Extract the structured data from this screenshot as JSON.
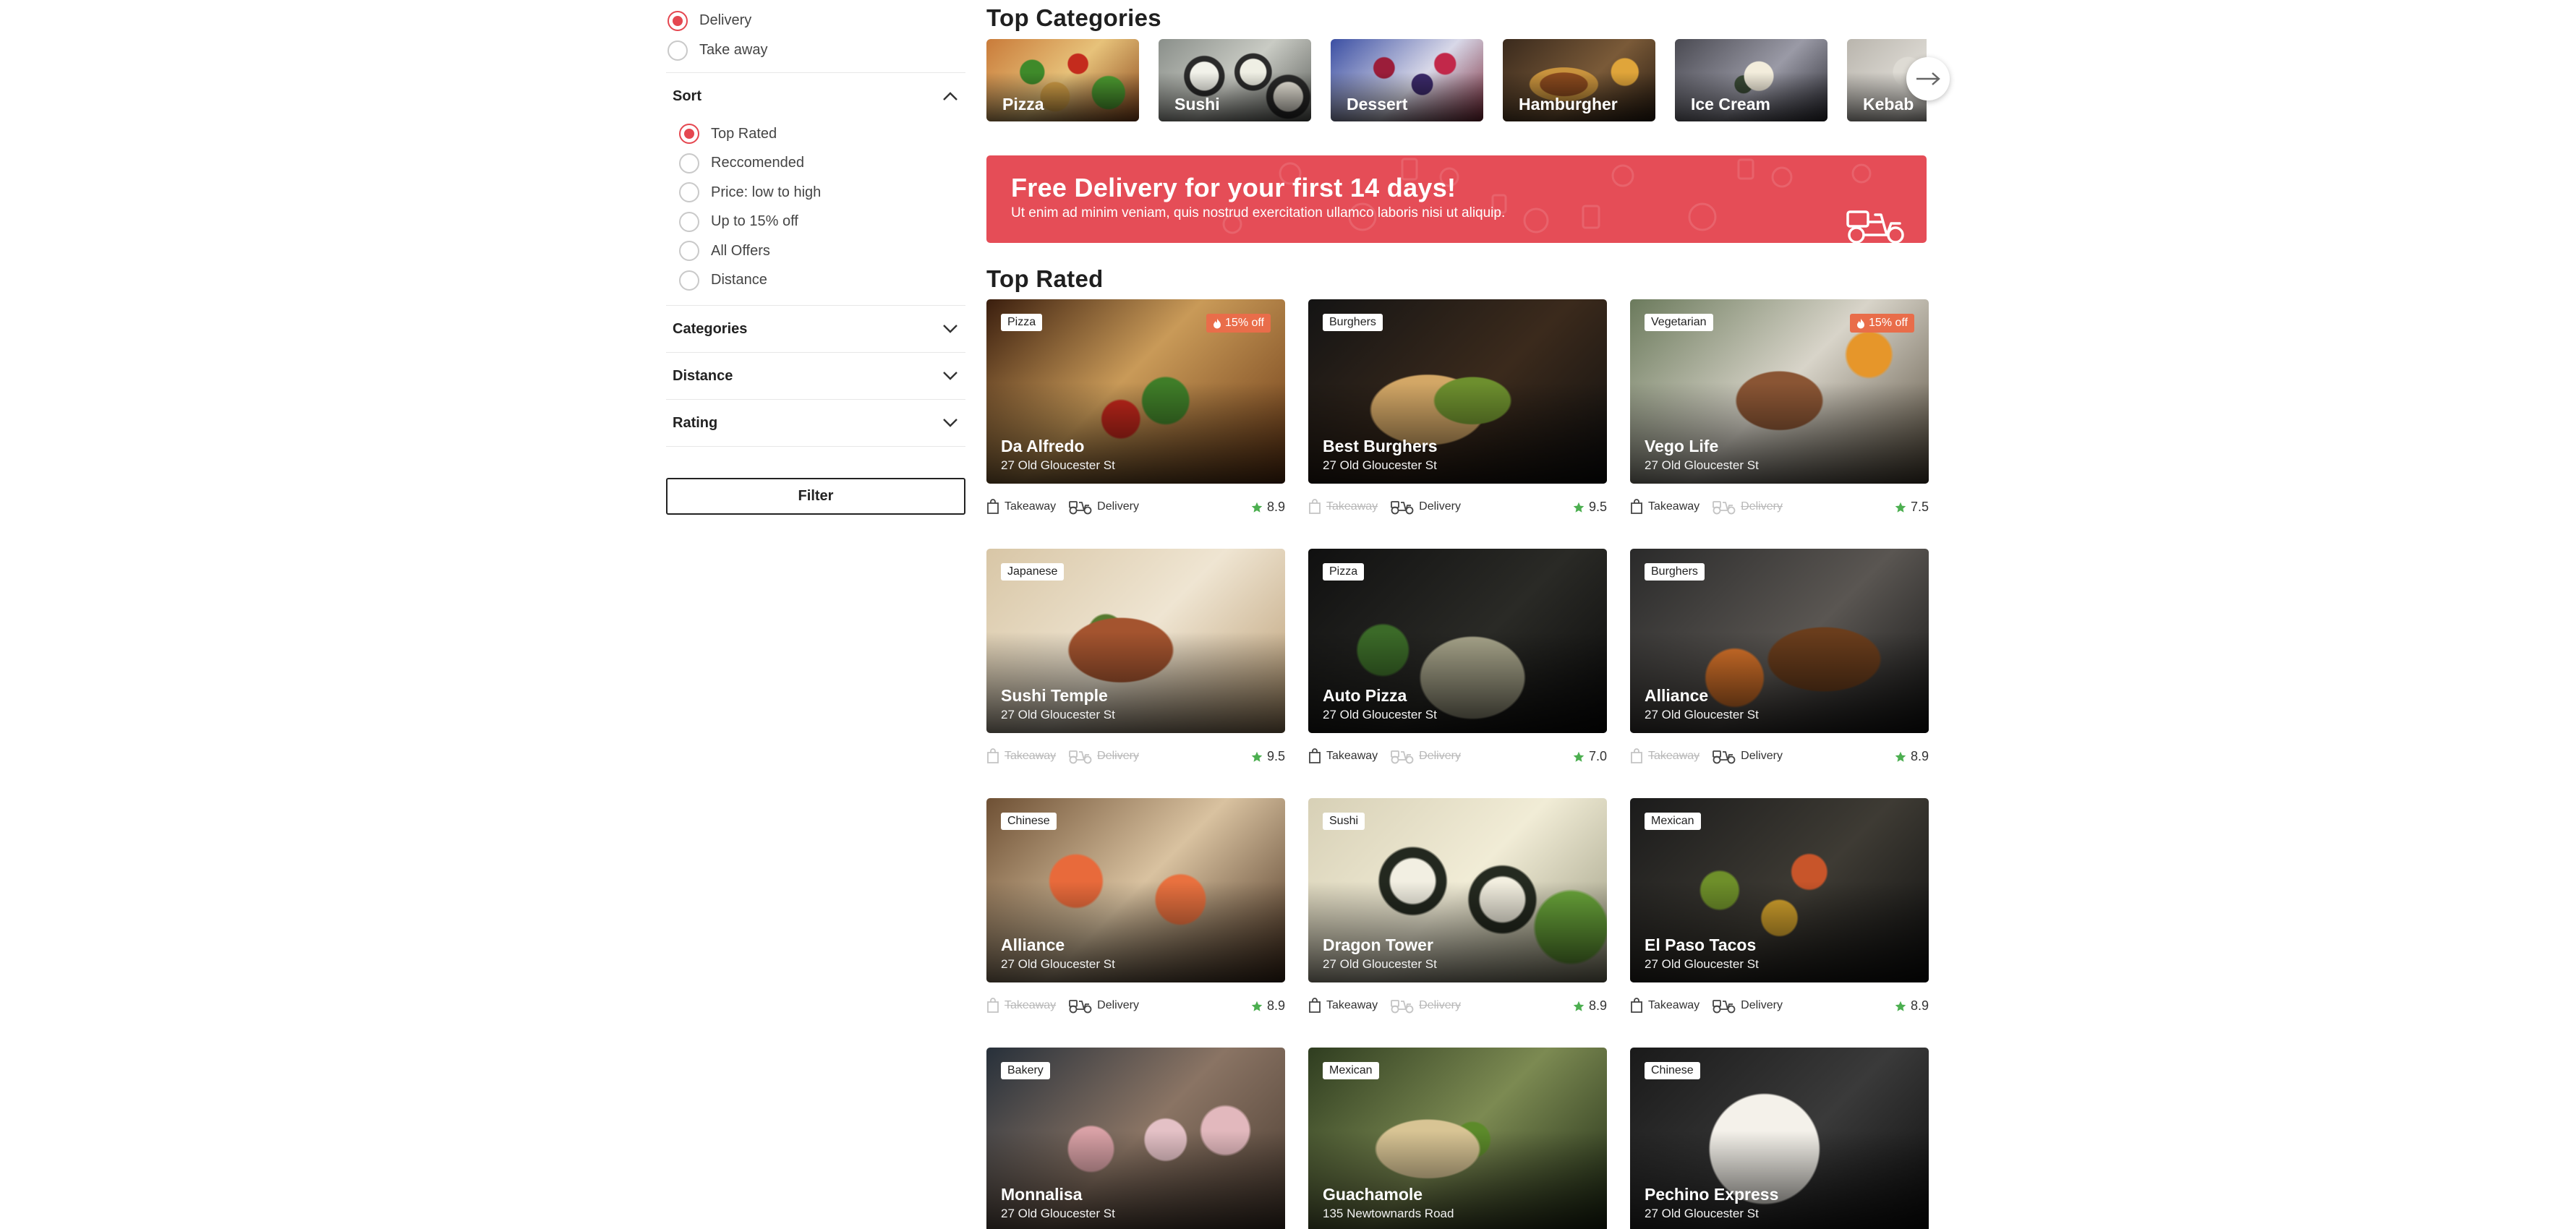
{
  "order_type": {
    "options": [
      {
        "label": "Delivery",
        "checked": true
      },
      {
        "label": "Take away",
        "checked": false
      }
    ]
  },
  "sort": {
    "title": "Sort",
    "options": [
      {
        "label": "Top Rated",
        "checked": true
      },
      {
        "label": "Reccomended",
        "checked": false
      },
      {
        "label": "Price: low to high",
        "checked": false
      },
      {
        "label": "Up to 15% off",
        "checked": false
      },
      {
        "label": "All Offers",
        "checked": false
      },
      {
        "label": "Distance",
        "checked": false
      }
    ]
  },
  "filters": {
    "categories": "Categories",
    "distance": "Distance",
    "rating": "Rating",
    "button": "Filter"
  },
  "top_categories": {
    "title": "Top Categories",
    "items": [
      "Pizza",
      "Sushi",
      "Dessert",
      "Hamburgher",
      "Ice Cream",
      "Kebab"
    ]
  },
  "promo": {
    "title": "Free Delivery for your first 14 days!",
    "subtitle": "Ut enim ad minim veniam, quis nostrud exercitation ullamco laboris nisi ut aliquip."
  },
  "top_rated": {
    "title": "Top Rated",
    "labels": {
      "takeaway": "Takeaway",
      "delivery": "Delivery"
    },
    "cards": [
      {
        "tag": "Pizza",
        "offer": "15% off",
        "name": "Da Alfredo",
        "address": "27 Old Gloucester St",
        "takeaway": true,
        "delivery": true,
        "rating": "8.9"
      },
      {
        "tag": "Burghers",
        "offer": "",
        "name": "Best Burghers",
        "address": "27 Old Gloucester St",
        "takeaway": false,
        "delivery": true,
        "rating": "9.5"
      },
      {
        "tag": "Vegetarian",
        "offer": "15% off",
        "name": "Vego Life",
        "address": "27 Old Gloucester St",
        "takeaway": true,
        "delivery": false,
        "rating": "7.5"
      },
      {
        "tag": "Japanese",
        "offer": "",
        "name": "Sushi Temple",
        "address": "27 Old Gloucester St",
        "takeaway": false,
        "delivery": false,
        "rating": "9.5"
      },
      {
        "tag": "Pizza",
        "offer": "",
        "name": "Auto Pizza",
        "address": "27 Old Gloucester St",
        "takeaway": true,
        "delivery": false,
        "rating": "7.0"
      },
      {
        "tag": "Burghers",
        "offer": "",
        "name": "Alliance",
        "address": "27 Old Gloucester St",
        "takeaway": false,
        "delivery": true,
        "rating": "8.9"
      },
      {
        "tag": "Chinese",
        "offer": "",
        "name": "Alliance",
        "address": "27 Old Gloucester St",
        "takeaway": false,
        "delivery": true,
        "rating": "8.9"
      },
      {
        "tag": "Sushi",
        "offer": "",
        "name": "Dragon Tower",
        "address": "27 Old Gloucester St",
        "takeaway": true,
        "delivery": false,
        "rating": "8.9"
      },
      {
        "tag": "Mexican",
        "offer": "",
        "name": "El Paso Tacos",
        "address": "27 Old Gloucester St",
        "takeaway": true,
        "delivery": true,
        "rating": "8.9"
      },
      {
        "tag": "Bakery",
        "offer": "",
        "name": "Monnalisa",
        "address": "27 Old Gloucester St",
        "takeaway": true,
        "delivery": true,
        "rating": ""
      },
      {
        "tag": "Mexican",
        "offer": "",
        "name": "Guachamole",
        "address": "135 Newtownards Road",
        "takeaway": true,
        "delivery": true,
        "rating": ""
      },
      {
        "tag": "Chinese",
        "offer": "",
        "name": "Pechino Express",
        "address": "27 Old Gloucester St",
        "takeaway": true,
        "delivery": true,
        "rating": ""
      }
    ]
  },
  "colors": {
    "accent": "#e54750",
    "promo": "#e54d57",
    "offer": "#e96d4a",
    "star": "#4caf50"
  }
}
